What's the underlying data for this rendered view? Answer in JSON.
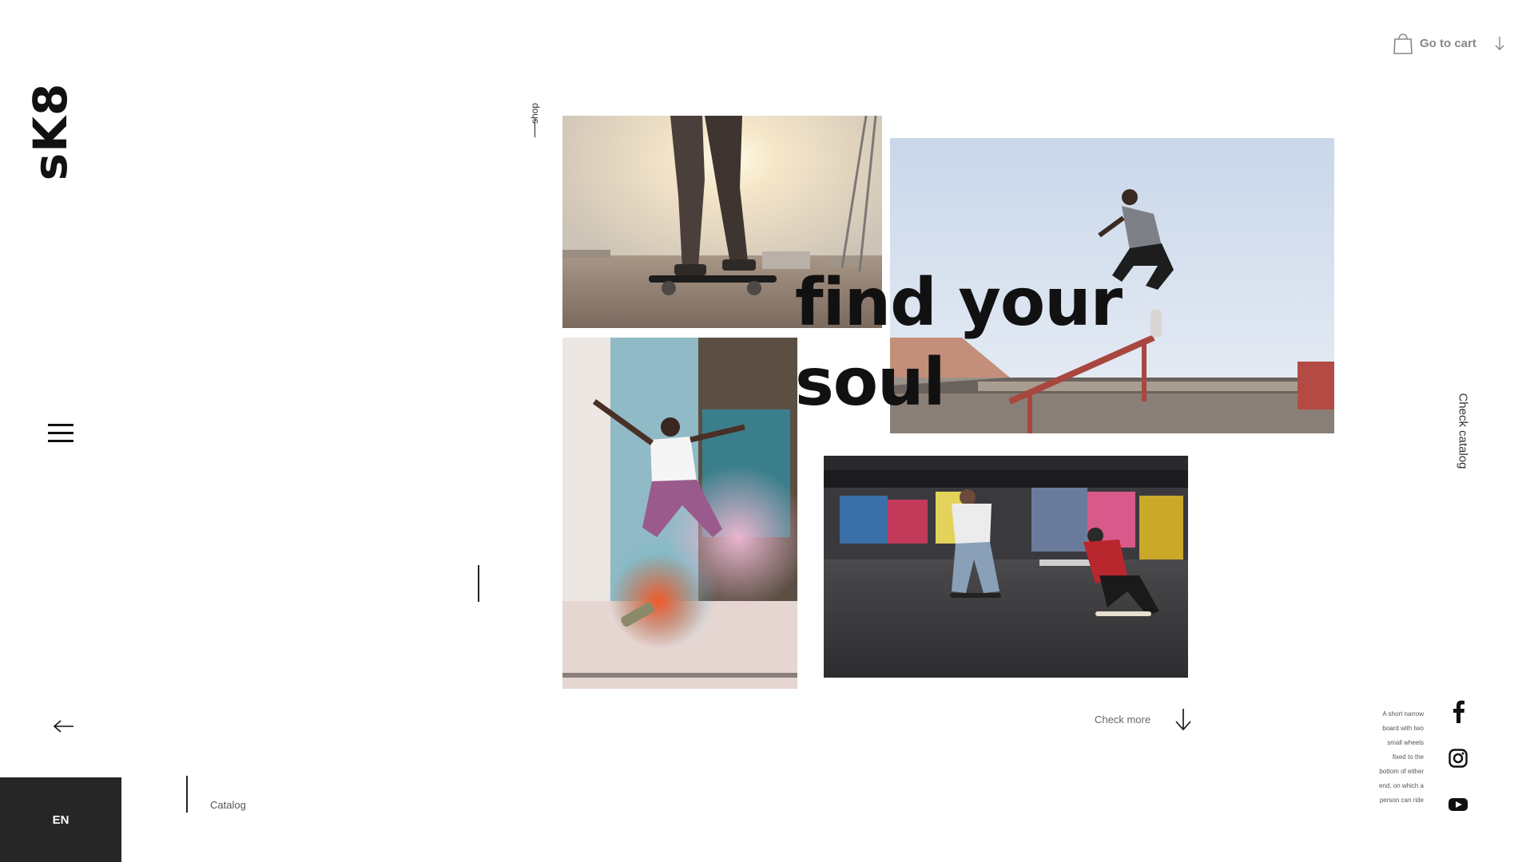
{
  "brand": {
    "logo_text": "sK8"
  },
  "nav": {
    "shop_label": "shop",
    "cart_label": "Go to cart",
    "check_catalog_label": "Check catalog",
    "catalog_label": "Catalog",
    "language": "EN"
  },
  "hero": {
    "headline_line1": "find your",
    "headline_line2": "soul",
    "check_more_label": "Check more"
  },
  "description": {
    "lines": [
      "A short narrow",
      "board with two",
      "small wheels",
      "fixed to the",
      "bottom of either",
      "end, on which a",
      "person can ride"
    ]
  },
  "icons": {
    "menu": "hamburger-icon",
    "back": "arrow-left-icon",
    "cart": "shopping-bag-icon",
    "cart_arrow": "arrow-down-icon",
    "check_more": "arrow-down-icon",
    "facebook": "facebook-icon",
    "instagram": "instagram-icon",
    "youtube": "youtube-icon"
  },
  "colors": {
    "dark": "#111111",
    "lang_bg": "#262626",
    "muted": "#888888"
  }
}
